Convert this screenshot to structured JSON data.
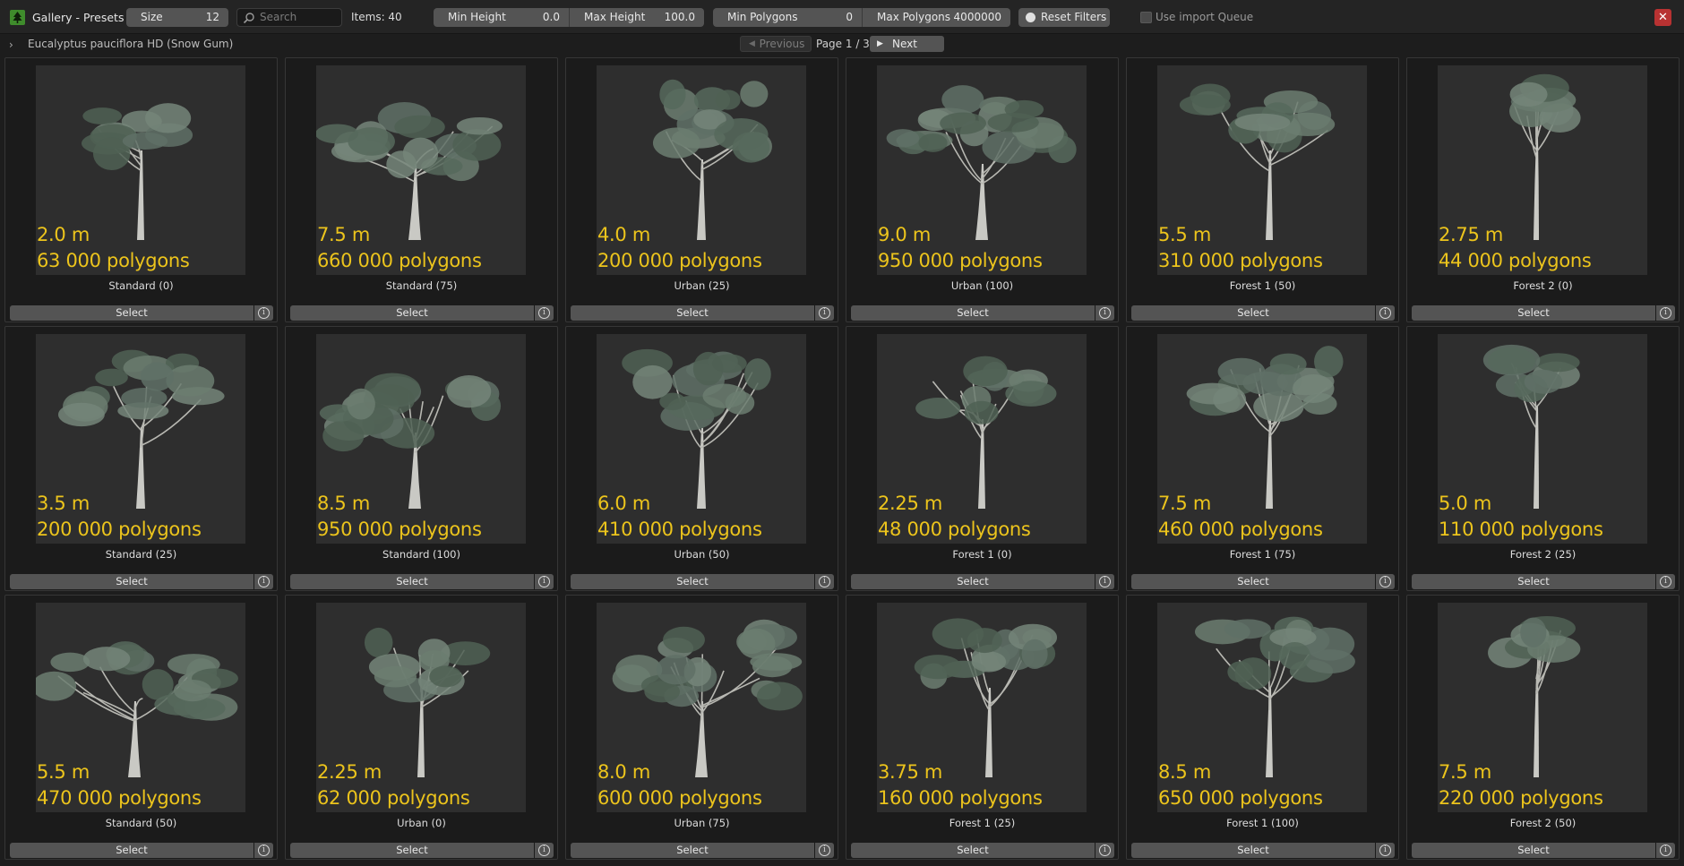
{
  "header": {
    "title": "Gallery - Presets",
    "size_label": "Size",
    "size_value": "12",
    "search_placeholder": "Search",
    "items_count": "Items: 40",
    "min_height_label": "Min Height",
    "min_height_value": "0.0",
    "max_height_label": "Max Height",
    "max_height_value": "100.0",
    "min_polygons_label": "Min Polygons",
    "min_polygons_value": "0",
    "max_polygons_label": "Max Polygons",
    "max_polygons_value": "4000000",
    "reset_label": "Reset Filters",
    "queue_label": "Use import Queue",
    "queue_checked": false,
    "close_symbol": "✕",
    "accent_color": "#3f8c2c",
    "close_color": "#b83232"
  },
  "subbar": {
    "breadcrumb": "Eucalyptus pauciflora HD (Snow Gum)",
    "prev_label": "Previous",
    "page": "Page 1 / 3",
    "next_label": "Next"
  },
  "card_button_label": "Select",
  "info_symbol": "i",
  "overlay_color": "#ecc41c",
  "cards": [
    {
      "height": "2.0 m",
      "polygons": "63 000 polygons",
      "title": "Standard (0)",
      "shape": "young"
    },
    {
      "height": "7.5 m",
      "polygons": "660 000 polygons",
      "title": "Standard (75)",
      "shape": "wide"
    },
    {
      "height": "4.0 m",
      "polygons": "200 000 polygons",
      "title": "Urban (25)",
      "shape": "round"
    },
    {
      "height": "9.0 m",
      "polygons": "950 000 polygons",
      "title": "Urban (100)",
      "shape": "full"
    },
    {
      "height": "5.5 m",
      "polygons": "310 000 polygons",
      "title": "Forest 1 (50)",
      "shape": "forest"
    },
    {
      "height": "2.75 m",
      "polygons": "44 000 polygons",
      "title": "Forest 2 (0)",
      "shape": "slim"
    },
    {
      "height": "3.5 m",
      "polygons": "200 000 polygons",
      "title": "Standard (25)",
      "shape": "round"
    },
    {
      "height": "8.5 m",
      "polygons": "950 000 polygons",
      "title": "Standard (100)",
      "shape": "wide"
    },
    {
      "height": "6.0 m",
      "polygons": "410 000 polygons",
      "title": "Urban (50)",
      "shape": "round"
    },
    {
      "height": "2.25 m",
      "polygons": "48 000 polygons",
      "title": "Forest 1 (0)",
      "shape": "young"
    },
    {
      "height": "7.5 m",
      "polygons": "460 000 polygons",
      "title": "Forest 1 (75)",
      "shape": "forest"
    },
    {
      "height": "5.0 m",
      "polygons": "110 000 polygons",
      "title": "Forest 2 (25)",
      "shape": "slim"
    },
    {
      "height": "5.5 m",
      "polygons": "470 000 polygons",
      "title": "Standard (50)",
      "shape": "wide"
    },
    {
      "height": "2.25 m",
      "polygons": "62 000 polygons",
      "title": "Urban (0)",
      "shape": "young"
    },
    {
      "height": "8.0 m",
      "polygons": "600 000 polygons",
      "title": "Urban (75)",
      "shape": "full"
    },
    {
      "height": "3.75 m",
      "polygons": "160 000 polygons",
      "title": "Forest 1 (25)",
      "shape": "forest"
    },
    {
      "height": "8.5 m",
      "polygons": "650 000 polygons",
      "title": "Forest 1 (100)",
      "shape": "forest"
    },
    {
      "height": "7.5 m",
      "polygons": "220 000 polygons",
      "title": "Forest 2 (50)",
      "shape": "slim"
    }
  ]
}
